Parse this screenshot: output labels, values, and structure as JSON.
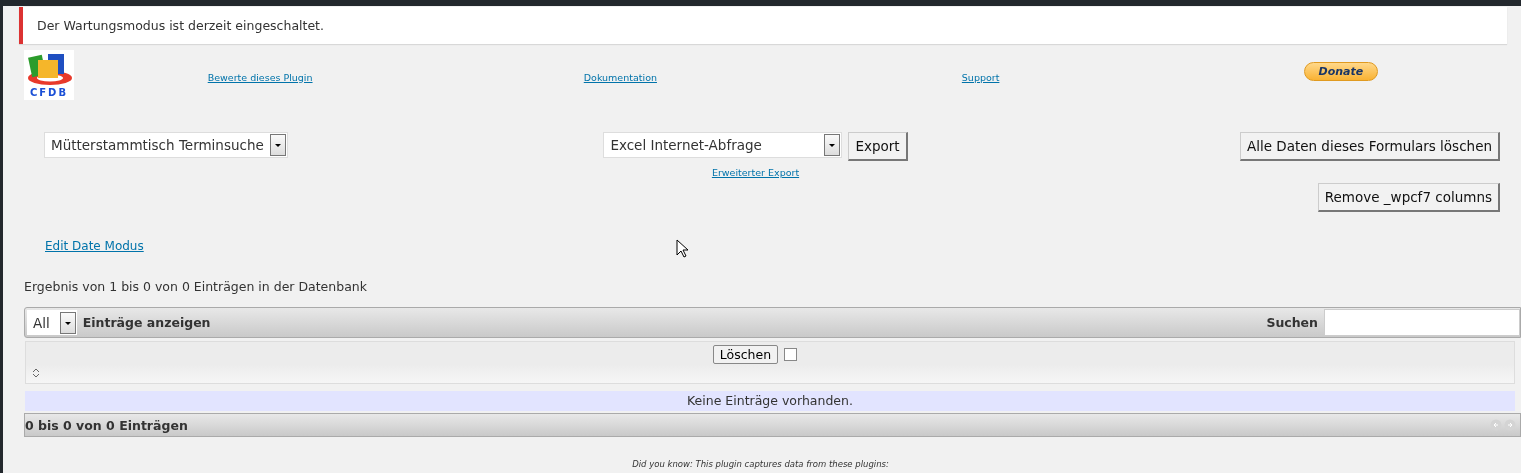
{
  "notice": {
    "text": "Der Wartungsmodus ist derzeit eingeschaltet."
  },
  "header": {
    "logo_text": "CFDB",
    "links": [
      "Bewerte dieses Plugin",
      "Dokumentation",
      "Support"
    ],
    "donate": "Donate"
  },
  "form_select": {
    "value": "Mütterstammtisch Terminsuche"
  },
  "export": {
    "format": "Excel Internet-Abfrage",
    "button": "Export",
    "advanced_link": "Erweiterter Export"
  },
  "actions": [
    "Alle Daten dieses Formulars löschen",
    "Remove _wpcf7 columns"
  ],
  "edit_link": "Edit Date Modus",
  "result_text": "Ergebnis von 1 bis 0 von 0 Einträgen in der Datenbank",
  "table": {
    "length_value": "All",
    "length_label": "Einträge anzeigen",
    "search_label": "Suchen",
    "delete_button": "Löschen",
    "select_all": {
      "checked": false
    },
    "empty_message": "Keine Einträge vorhanden.",
    "info": "0 bis 0 von 0 Einträgen"
  },
  "footer_note": "Did you know: This plugin captures data from these plugins:"
}
